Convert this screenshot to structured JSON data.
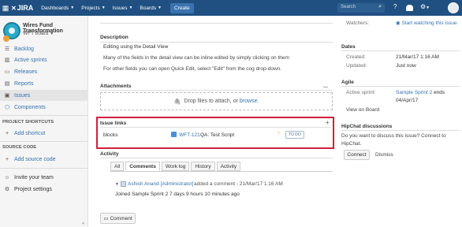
{
  "topnav": {
    "logo": "JIRA",
    "menus": [
      "Dashboards",
      "Projects",
      "Issues",
      "Boards"
    ],
    "create": "Create",
    "search_placeholder": "Search",
    "help_icon": "?",
    "settings_icon": "⚙"
  },
  "sidebar": {
    "project_name": "Wires Fund Transformation",
    "board": "WFT board",
    "items": [
      {
        "label": "Backlog",
        "icon": "backlog-icon"
      },
      {
        "label": "Active sprints",
        "icon": "sprints-icon"
      },
      {
        "label": "Releases",
        "icon": "releases-icon"
      },
      {
        "label": "Reports",
        "icon": "reports-icon"
      },
      {
        "label": "Issues",
        "icon": "issues-icon"
      },
      {
        "label": "Components",
        "icon": "components-icon"
      }
    ],
    "shortcuts_title": "PROJECT SHORTCUTS",
    "add_shortcut": "Add shortcut",
    "source_title": "SOURCE CODE",
    "add_source": "Add source code",
    "invite": "Invite your team",
    "settings": "Project settings",
    "collapse": "«"
  },
  "description": {
    "title": "Description",
    "heading": "Editing using the Detail View",
    "line1": "Many of the fields in the detail view can be inline edited by simply clicking on them",
    "line2": "For other fields you can open Quick Edit, select \"Edit\" from the cog drop-down."
  },
  "attachments": {
    "title": "Attachments",
    "menu": "...",
    "drop_text": "Drop files to attach, or",
    "browse": "browse."
  },
  "issue_links": {
    "title": "Issue links",
    "relation": "blocks",
    "key": "WFT-121",
    "summary": "QA: Test Script",
    "priority": "↑",
    "status": "TO DO"
  },
  "activity": {
    "title": "Activity",
    "tabs": [
      "All",
      "Comments",
      "Work log",
      "History",
      "Activity"
    ],
    "comment_author": "Ashish Anand [Administrator]",
    "comment_meta": "added a comment - 21/Mar/17 1:16 AM",
    "comment_body": "Joined Sample Sprint 2 7 days 9 hours 10 minutes ago",
    "comment_button": "Comment"
  },
  "right": {
    "watchers_label": "Watchers:",
    "watch_link": "Start watching this issue",
    "dates_title": "Dates",
    "created_label": "Created:",
    "created_value": "21/Mar/17 1:16 AM",
    "updated_label": "Updated:",
    "updated_value": "Just now",
    "agile_title": "Agile",
    "sprint_label": "Active sprint:",
    "sprint_value": "Sample Sprint 2",
    "sprint_ends": "ends",
    "sprint_date": "04/Apr/17",
    "view_board": "View on Board",
    "hipchat_title": "HipChat discussions",
    "hipchat_text1": "Do you want to discuss this issue? Connect to",
    "hipchat_text2": "HipChat.",
    "connect": "Connect",
    "dismiss": "Dismiss"
  }
}
